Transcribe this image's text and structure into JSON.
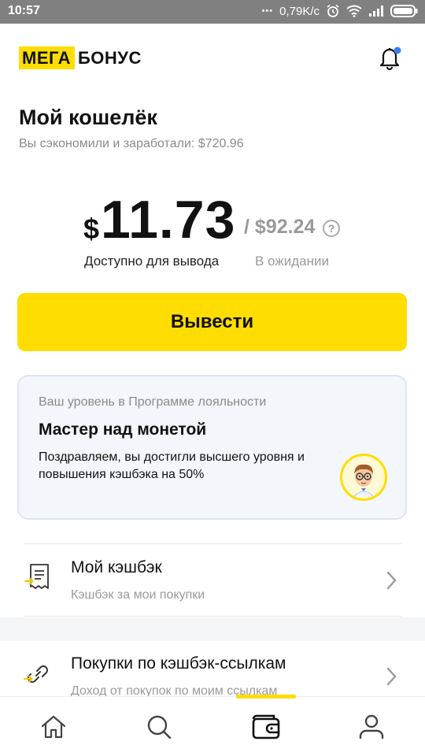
{
  "status_bar": {
    "time": "10:57",
    "speed": "0,79K/с"
  },
  "header": {
    "logo_part1": "МЕГА",
    "logo_part2": "БОНУС",
    "notification_dot_color": "#3d7ff0"
  },
  "wallet": {
    "title": "Мой кошелёк",
    "savings_text": "Вы сэкономили и заработали: $720.96",
    "currency_symbol": "$",
    "available_amount": "11.73",
    "pending_amount": "/ $92.24",
    "help_symbol": "?",
    "available_caption": "Доступно для вывода",
    "pending_caption": "В ожидании"
  },
  "withdraw_button": "Вывести",
  "loyalty": {
    "label": "Ваш уровень в Программе лояльности",
    "level_name": "Мастер над монетой",
    "description": "Поздравляем, вы достигли высшего уровня и повышения кэшбэка на 50%"
  },
  "menu": [
    {
      "title": "Мой кэшбэк",
      "subtitle": "Кэшбэк за мои покупки",
      "icon": "receipt-icon"
    },
    {
      "title": "Покупки по кэшбэк-ссылкам",
      "subtitle": "Доход от покупок по моим ссылкам",
      "icon": "link-icon"
    }
  ],
  "bottom_nav": {
    "items": [
      "home-icon",
      "search-icon",
      "wallet-icon",
      "profile-icon"
    ],
    "active": "wallet-icon"
  },
  "colors": {
    "accent": "#ffdd00",
    "text": "#111111",
    "muted": "#9a9a9a",
    "card_bg": "#f3f7fb",
    "icon_accent": "#f5c400"
  }
}
